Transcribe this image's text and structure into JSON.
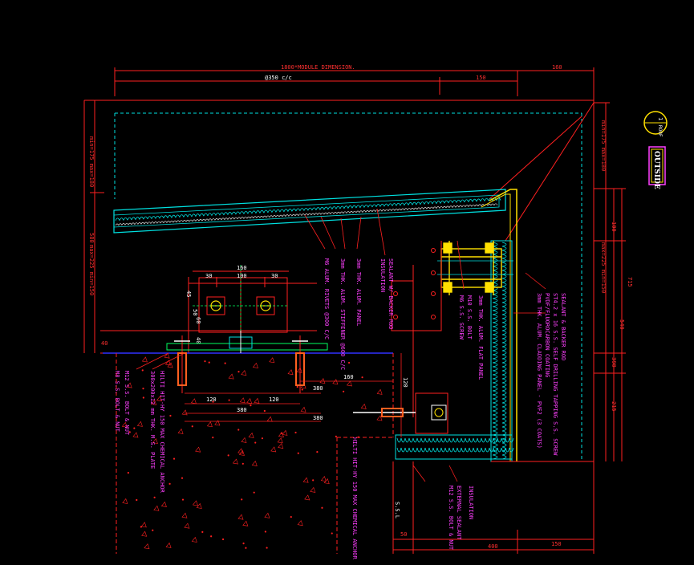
{
  "drawing": {
    "colors": {
      "background": "#000000",
      "dimension": "#ff2020",
      "panel": "#00e0e0",
      "steel": "#ffe000",
      "annotation": "#ff40ff",
      "slab_edge": "#3030ff"
    },
    "top_dims": {
      "module": "1800*MODULE DIMENSION.",
      "spacing": "@350 c/c",
      "d160": "160",
      "d150": "150"
    },
    "left_dims": {
      "d580": "580",
      "offset_top": "min=175  max=180",
      "offset_mid": "max=225  min=150",
      "d40": "40"
    },
    "right_dims": {
      "offset_top": "min=175  max=180",
      "d100": "100",
      "offset_mid": "max=225  min=150",
      "d715": "715",
      "d540": "540",
      "d390": "390",
      "d215": "215"
    },
    "bracket_dims": {
      "d160": "160",
      "d100": "100",
      "d30a": "30",
      "d30b": "30",
      "d45": "45",
      "d50": "50",
      "d60": "60",
      "d40": "40"
    },
    "slab_dims": {
      "d120a": "120",
      "d120b": "120",
      "d380a": "380",
      "d380b": "380",
      "d380c": "380",
      "d160": "160",
      "d120c": "120"
    },
    "bottom_dims": {
      "d50": "50",
      "d400": "400",
      "d150": "150",
      "sill": "S.S.L"
    },
    "outside_label": "OUTSIDE",
    "section_marker": {
      "number": "1",
      "ref": "ROOF"
    },
    "notes_panel": [
      "SEALANT W/ BACKER ROD",
      "INSULATION",
      "3mm THK. ALUM. PANEL",
      "3mm THK. ALUM. STIFFENER @600 C/C",
      "M6 ALUM. RIVETS @300 C/C"
    ],
    "notes_bracket": [
      "M10 S.S. BOLT",
      "3mm THK. ALUM. FLAT PANEL",
      "M6 S.S. SCREW"
    ],
    "notes_right": [
      "SEALANT & BACKER ROD",
      "ST4.2 x 16 S.S. SELF DRILLING TAPPING S.S. SCREW",
      "PVDF/FLUOROCARBON COATING",
      "3mm THK. ALUM. CLADDING PANEL - PVF2 (3 COATS)"
    ],
    "notes_anchor": [
      "HILTI HIT-HY 150 MAX CHEMICAL ANCHOR",
      "300x200x12 mm THK. M.S. PLATE",
      "M12 S.S. BOLT & NUT",
      "M8 S.S. BOLT & NUT"
    ],
    "notes_bottom": [
      "HILTI HIT-HY 150 MAX CHEMICAL ANCHOR",
      "M12 S.S. BOLT & NUT",
      "EXTERNAL SEALANT",
      "INSULATION"
    ]
  }
}
